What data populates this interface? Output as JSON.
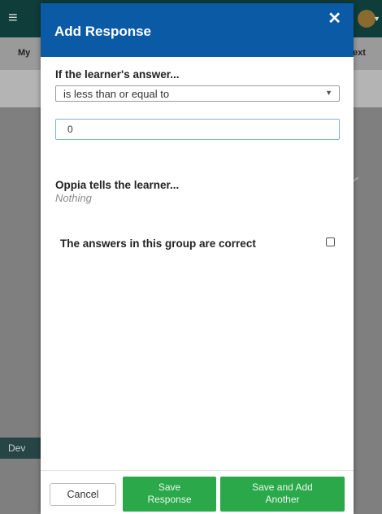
{
  "background": {
    "menu_icon": "hamburger-icon",
    "left_label": "My",
    "right_label": "ext",
    "dev_label": "Dev"
  },
  "modal": {
    "title": "Add Response",
    "close_icon": "close-icon",
    "rule_label": "If the learner's answer...",
    "rule_select_value": "is less than or equal to",
    "input_value": "0",
    "feedback_label": "Oppia tells the learner...",
    "feedback_value": "Nothing",
    "correct_label": "The answers in this group are correct",
    "correct_checked": false,
    "buttons": {
      "cancel": "Cancel",
      "save_line1": "Save",
      "save_line2": "Response",
      "save_add_line1": "Save and Add",
      "save_add_line2": "Another"
    }
  },
  "colors": {
    "header": "#0b5aa6",
    "primary_button": "#2aa84a",
    "topbar": "#0e3d3a"
  }
}
